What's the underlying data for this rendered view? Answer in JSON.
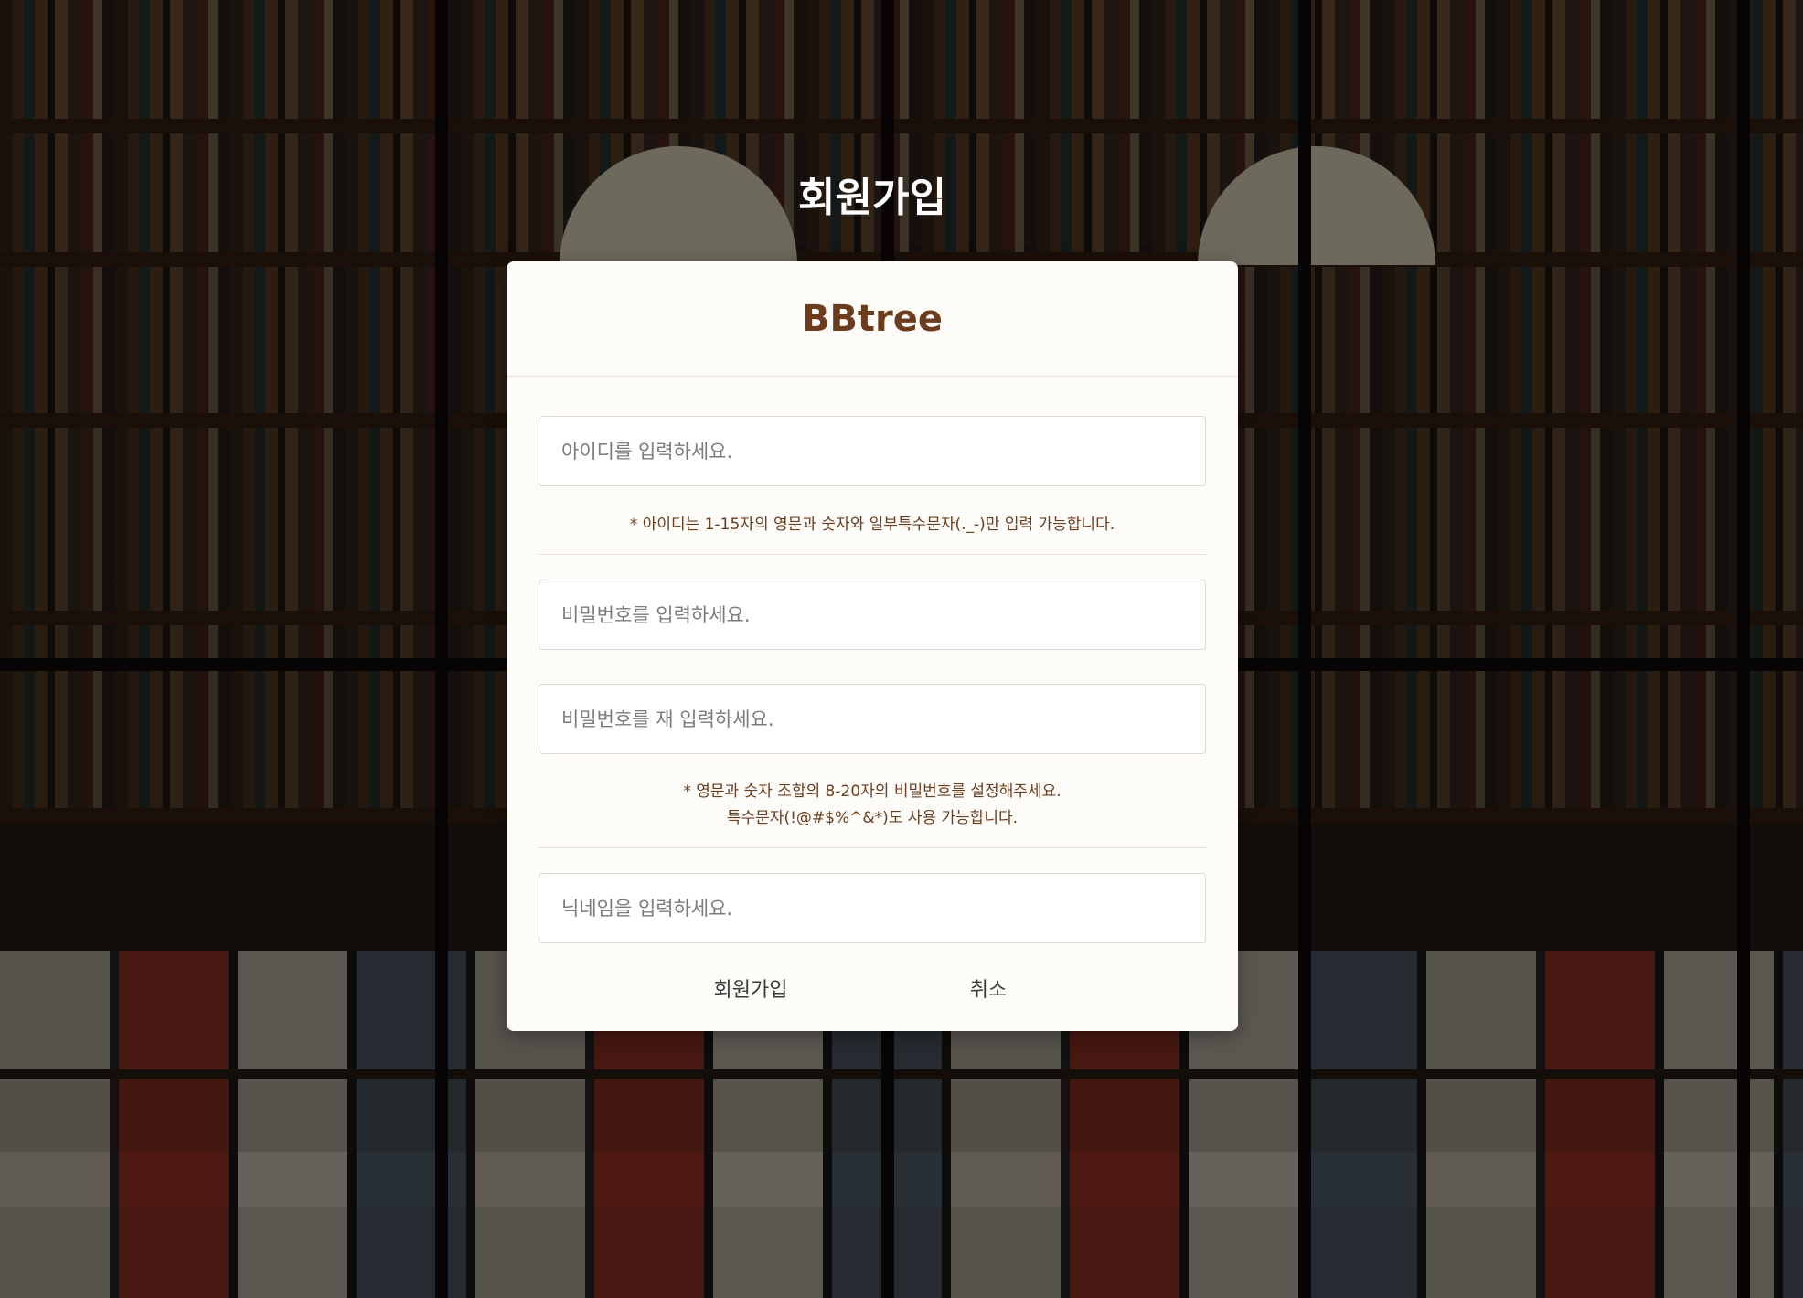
{
  "page": {
    "title": "회원가입"
  },
  "card": {
    "brand": "BBtree"
  },
  "form": {
    "id_placeholder": "아이디를 입력하세요.",
    "id_hint": "* 아이디는 1-15자의 영문과 숫자와 일부특수문자(._-)만 입력 가능합니다.",
    "password_placeholder": "비밀번호를 입력하세요.",
    "password_confirm_placeholder": "비밀번호를 재 입력하세요.",
    "password_hint_line1": "* 영문과 숫자 조합의 8-20자의 비밀번호를 설정해주세요.",
    "password_hint_line2": "특수문자(!@#$%^&*)도 사용 가능합니다.",
    "nickname_placeholder": "닉네임을 입력하세요."
  },
  "actions": {
    "signup_label": "회원가입",
    "cancel_label": "취소"
  },
  "colors": {
    "brand": "#6b3d1e",
    "card_background": "#fdfcf8",
    "hint_text": "#6b3d1e"
  }
}
